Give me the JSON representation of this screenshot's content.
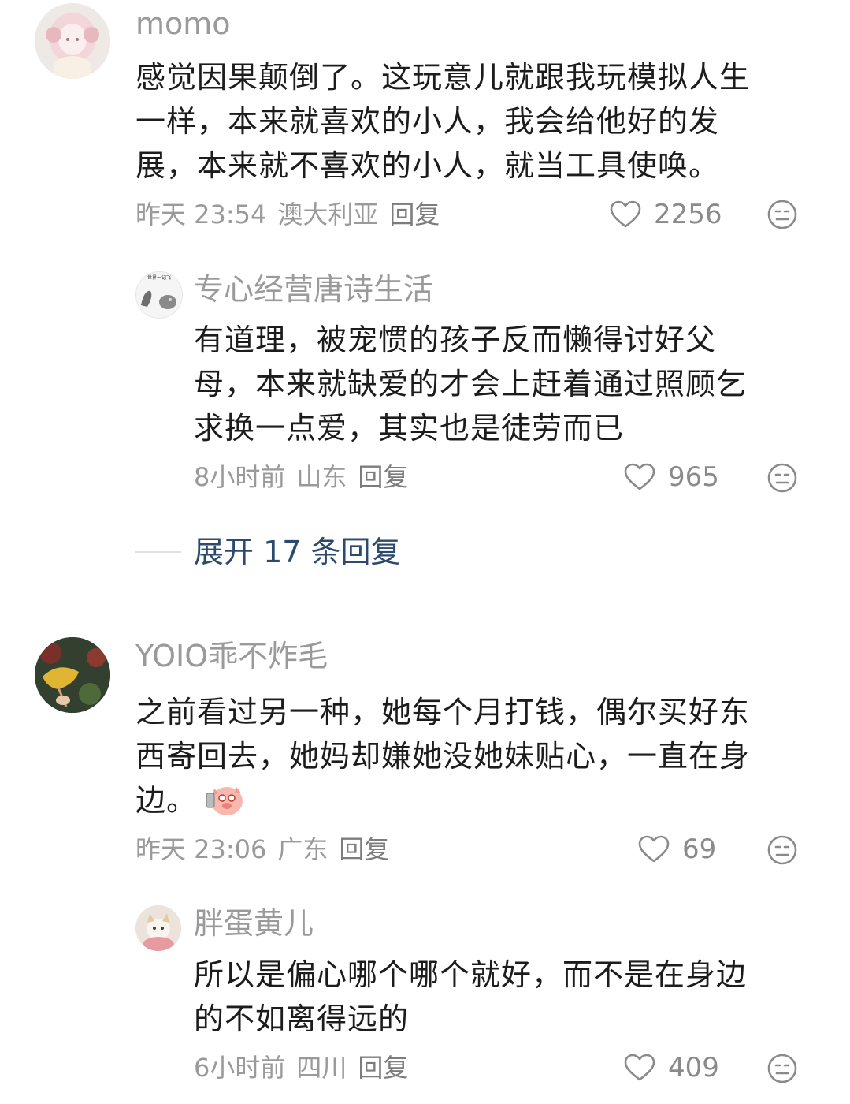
{
  "comments": [
    {
      "username": "momo",
      "text_lines": [
        "感觉因果颠倒了。这玩意儿就跟我玩模拟人生",
        "一样，本来就喜欢的小人，我会给他好的发",
        "展，本来就不喜欢的小人，就当工具使唤。"
      ],
      "time": "昨天 23:54",
      "location": "澳大利亚",
      "reply_label": "回复",
      "likes": "2256",
      "reply": {
        "username": "专心经营唐诗生活",
        "avatar_text": "世界一记飞",
        "text_lines": [
          "有道理，被宠惯的孩子反而懒得讨好父",
          "母，本来就缺爱的才会上赶着通过照顾乞",
          "求换一点爱，其实也是徒劳而已"
        ],
        "time": "8小时前",
        "location": "山东",
        "reply_label": "回复",
        "likes": "965"
      },
      "expand_label": "展开 17 条回复"
    },
    {
      "username": "YOIO乖不炸毛",
      "text_lines": [
        "之前看过另一种，她每个月打钱，偶尔买好东",
        "西寄回去，她妈却嫌她没她妹贴心，一直在身",
        "边。"
      ],
      "time": "昨天 23:06",
      "location": "广东",
      "reply_label": "回复",
      "likes": "69",
      "reply": {
        "username": "胖蛋黄儿",
        "text_lines": [
          "所以是偏心哪个哪个就好，而不是在身边",
          "的不如离得远的"
        ],
        "time": "6小时前",
        "location": "四川",
        "reply_label": "回复",
        "likes": "409"
      }
    }
  ],
  "icons": {
    "like": "heart-outline-icon",
    "dislike": "meh-face-icon",
    "sticker": "pig-face-sticker"
  },
  "colors": {
    "text": "#1c1c1c",
    "meta": "#9a9a9a",
    "expand": "#2c4a6e"
  }
}
